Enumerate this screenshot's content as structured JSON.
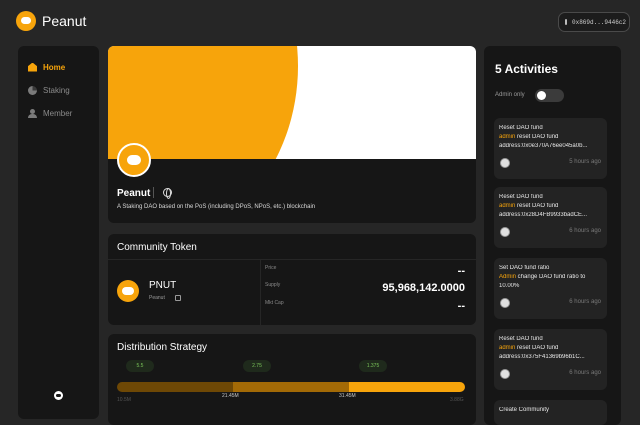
{
  "app": {
    "name": "Peanut",
    "wallet_address": "0x869d...9446c2"
  },
  "sidebar": {
    "items": [
      {
        "label": "Home",
        "icon": "home-icon",
        "active": true
      },
      {
        "label": "Staking",
        "icon": "pie-chart-icon",
        "active": false
      },
      {
        "label": "Member",
        "icon": "user-icon",
        "active": false
      }
    ],
    "footer_icon": "twitter-icon"
  },
  "dao": {
    "name": "Peanut",
    "description": "A Staking DAO based on the PoS (including DPoS, NPoS, etc.) blockchain"
  },
  "token": {
    "section_title": "Community Token",
    "symbol": "PNUT",
    "name": "Peanut",
    "stats": [
      {
        "label": "Price",
        "value": "--"
      },
      {
        "label": "Supply",
        "value": "95,968,142.0000"
      },
      {
        "label": "Mkt Cap",
        "value": "--"
      }
    ]
  },
  "distribution": {
    "section_title": "Distribution Strategy",
    "pills": [
      "5.5",
      "2.75",
      "1.375"
    ],
    "ticks": [
      "10.5M",
      "21.45M",
      "31.45M",
      "3.88G"
    ]
  },
  "activities": {
    "title": "5 Activities",
    "admin_only_label": "Admin only",
    "admin_only_enabled": false,
    "items": [
      {
        "title": "Reset DAO fund",
        "actor": "admin",
        "action": " reset DAO fund",
        "detail": "address:0x0e370A76ee045a0b...",
        "time": "5 hours ago"
      },
      {
        "title": "Reset DAO fund",
        "actor": "admin",
        "action": " reset DAO fund",
        "detail": "address:0x28D4FB9933badCE...",
        "time": "6 hours ago"
      },
      {
        "title": "Set DAO fund ratio",
        "actor": "Admin",
        "action": " change DAO fund ratio to",
        "detail": "10.00%",
        "time": "6 hours ago"
      },
      {
        "title": "Reset DAO fund",
        "actor": "admin",
        "action": " reset DAO fund",
        "detail": "address:0x375F41369b96b1C...",
        "time": "6 hours ago"
      },
      {
        "title": "Create Community"
      }
    ]
  },
  "colors": {
    "accent": "#f7a40b",
    "background": "#262626",
    "card": "#161616"
  }
}
